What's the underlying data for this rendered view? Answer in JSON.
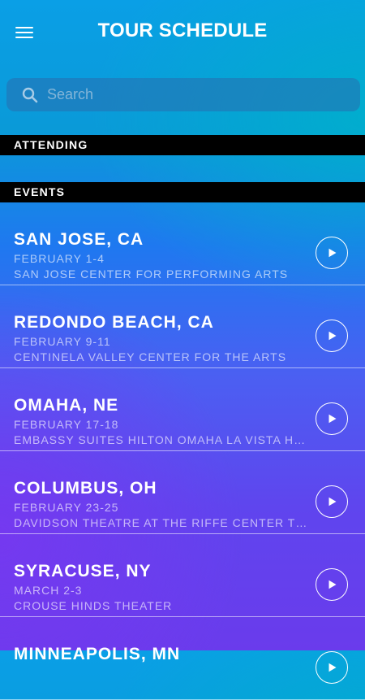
{
  "header": {
    "title": "TOUR SCHEDULE",
    "menu_icon": "hamburger-menu-icon"
  },
  "search": {
    "placeholder": "Search",
    "value": "",
    "icon": "search-icon"
  },
  "sections": {
    "attending": "ATTENDING",
    "events": "EVENTS"
  },
  "events": [
    {
      "city": "SAN JOSE, CA",
      "dates": "FEBRUARY 1-4",
      "venue": "SAN JOSE CENTER FOR PERFORMING ARTS"
    },
    {
      "city": "REDONDO BEACH, CA",
      "dates": "FEBRUARY 9-11",
      "venue": "CENTINELA VALLEY CENTER FOR THE ARTS"
    },
    {
      "city": "OMAHA, NE",
      "dates": "FEBRUARY 17-18",
      "venue": "EMBASSY SUITES HILTON OMAHA LA VISTA HO..."
    },
    {
      "city": "COLUMBUS, OH",
      "dates": "FEBRUARY 23-25",
      "venue": "DAVIDSON THEATRE AT THE RIFFE CENTER THE..."
    },
    {
      "city": "SYRACUSE, NY",
      "dates": "MARCH 2-3",
      "venue": "CROUSE HINDS THEATER"
    },
    {
      "city": "MINNEAPOLIS, MN",
      "dates": "",
      "venue": ""
    }
  ],
  "colors": {
    "accent_top": "#0a9fe6",
    "accent_bottom": "#6a3bec",
    "section_bar": "#000000",
    "text": "#ffffff"
  }
}
